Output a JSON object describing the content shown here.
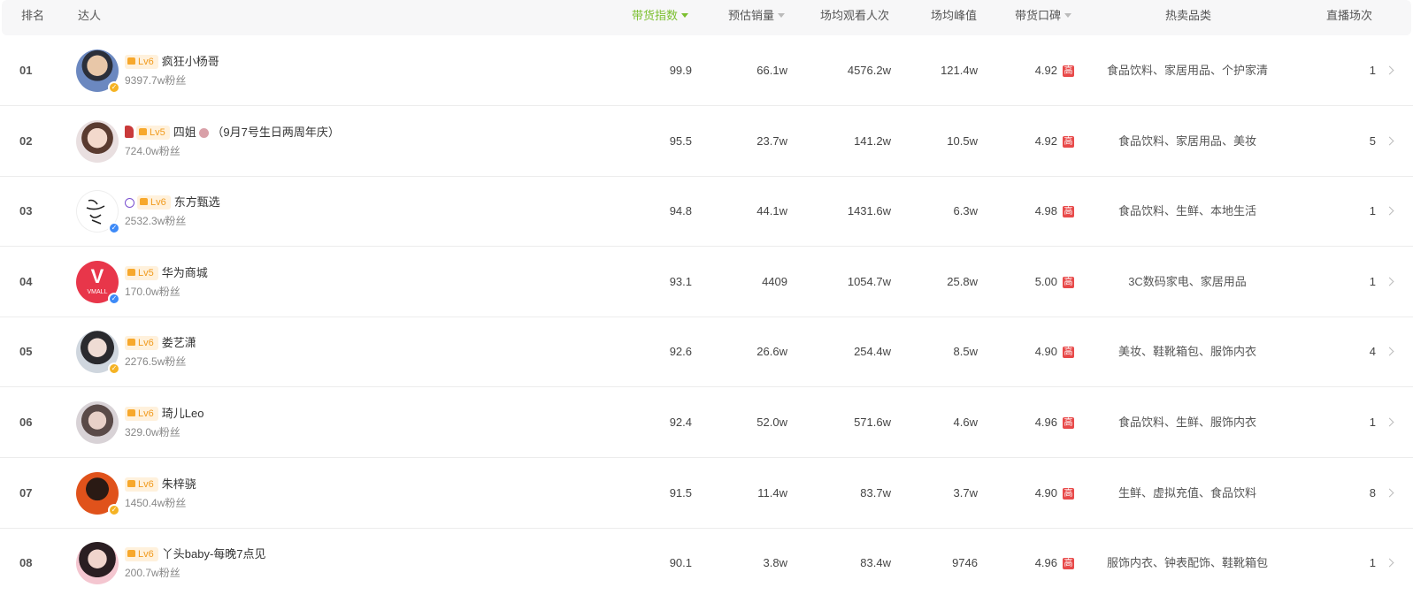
{
  "columns": {
    "rank": "排名",
    "influencer": "达人",
    "gmv_index": "带货指数",
    "est_sales": "预估销量",
    "avg_viewers": "场均观看人次",
    "avg_peak": "场均峰值",
    "reputation": "带货口碑",
    "hot_categories": "热卖品类",
    "live_count": "直播场次"
  },
  "active_sort_color": "#7bbf2f",
  "rows": [
    {
      "rank": "01",
      "level": "Lv6",
      "name": "疯狂小杨哥",
      "fans": "9397.7w粉丝",
      "gmv_index": "99.9",
      "est_sales": "66.1w",
      "avg_viewers": "4576.2w",
      "avg_peak": "121.4w",
      "reputation": "4.92",
      "rep_tag": "高",
      "categories": "食品饮料、家居用品、个护家清",
      "live_count": "1",
      "verify": "gold"
    },
    {
      "rank": "02",
      "level": "Lv5",
      "name": "四姐",
      "name_suffix": "（9月7号生日两周年庆）",
      "fans": "724.0w粉丝",
      "gmv_index": "95.5",
      "est_sales": "23.7w",
      "avg_viewers": "141.2w",
      "avg_peak": "10.5w",
      "reputation": "4.92",
      "rep_tag": "高",
      "categories": "食品饮料、家居用品、美妆",
      "live_count": "5",
      "verify": "none"
    },
    {
      "rank": "03",
      "level": "Lv6",
      "name": "东方甄选",
      "fans": "2532.3w粉丝",
      "gmv_index": "94.8",
      "est_sales": "44.1w",
      "avg_viewers": "1431.6w",
      "avg_peak": "6.3w",
      "reputation": "4.98",
      "rep_tag": "高",
      "categories": "食品饮料、生鲜、本地生活",
      "live_count": "1",
      "verify": "blue"
    },
    {
      "rank": "04",
      "level": "Lv5",
      "name": "华为商城",
      "fans": "170.0w粉丝",
      "gmv_index": "93.1",
      "est_sales": "4409",
      "avg_viewers": "1054.7w",
      "avg_peak": "25.8w",
      "reputation": "5.00",
      "rep_tag": "高",
      "categories": "3C数码家电、家居用品",
      "live_count": "1",
      "verify": "blue",
      "avatar_text": "VMALL"
    },
    {
      "rank": "05",
      "level": "Lv6",
      "name": "娄艺潇",
      "fans": "2276.5w粉丝",
      "gmv_index": "92.6",
      "est_sales": "26.6w",
      "avg_viewers": "254.4w",
      "avg_peak": "8.5w",
      "reputation": "4.90",
      "rep_tag": "高",
      "categories": "美妆、鞋靴箱包、服饰内衣",
      "live_count": "4",
      "verify": "gold"
    },
    {
      "rank": "06",
      "level": "Lv6",
      "name": "琦儿Leo",
      "fans": "329.0w粉丝",
      "gmv_index": "92.4",
      "est_sales": "52.0w",
      "avg_viewers": "571.6w",
      "avg_peak": "4.6w",
      "reputation": "4.96",
      "rep_tag": "高",
      "categories": "食品饮料、生鲜、服饰内衣",
      "live_count": "1",
      "verify": "none"
    },
    {
      "rank": "07",
      "level": "Lv6",
      "name": "朱梓骁",
      "fans": "1450.4w粉丝",
      "gmv_index": "91.5",
      "est_sales": "11.4w",
      "avg_viewers": "83.7w",
      "avg_peak": "3.7w",
      "reputation": "4.90",
      "rep_tag": "高",
      "categories": "生鲜、虚拟充值、食品饮料",
      "live_count": "8",
      "verify": "gold"
    },
    {
      "rank": "08",
      "level": "Lv6",
      "name": "丫头baby-每晚7点见",
      "fans": "200.7w粉丝",
      "gmv_index": "90.1",
      "est_sales": "3.8w",
      "avg_viewers": "83.4w",
      "avg_peak": "9746",
      "reputation": "4.96",
      "rep_tag": "高",
      "categories": "服饰内衣、钟表配饰、鞋靴箱包",
      "live_count": "1",
      "verify": "none"
    }
  ]
}
